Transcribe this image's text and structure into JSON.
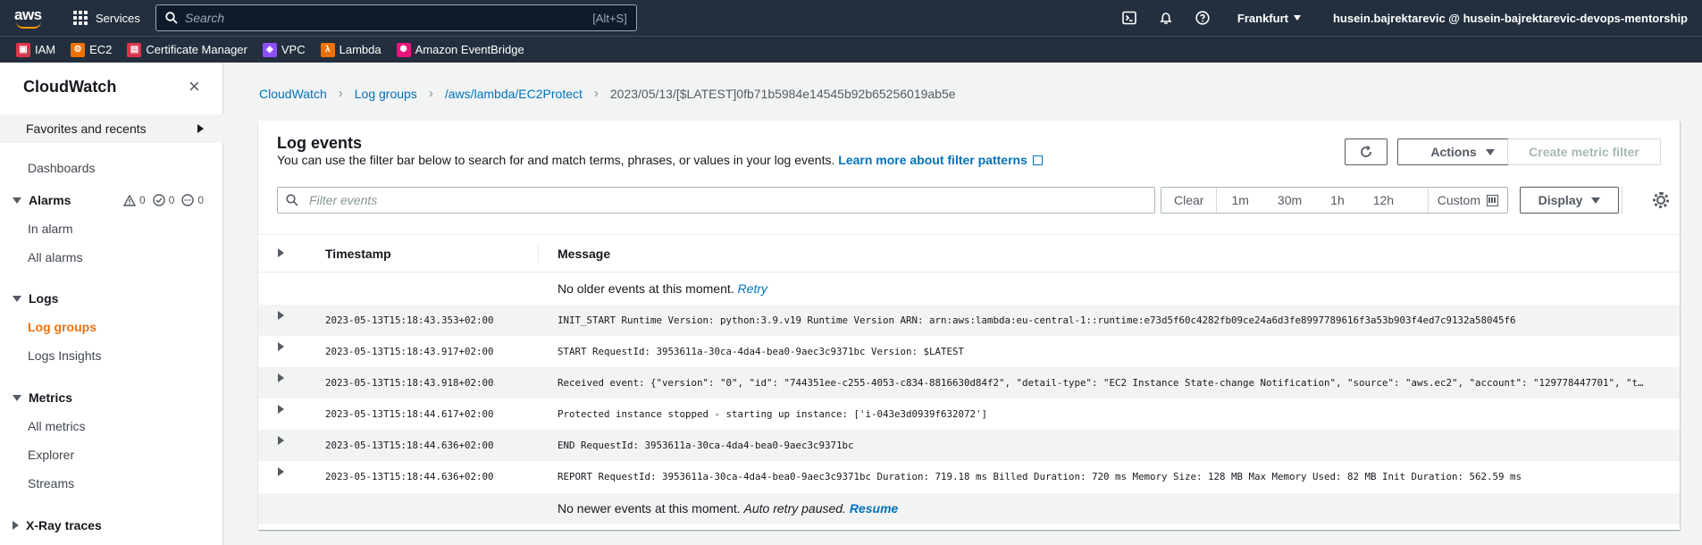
{
  "topnav": {
    "logo": "aws",
    "services_label": "Services",
    "search_placeholder": "Search",
    "search_shortcut": "[Alt+S]",
    "region": "Frankfurt",
    "account": "husein.bajrektarevic @ husein-bajrektarevic-devops-mentorship"
  },
  "favorites": [
    {
      "label": "IAM",
      "icon": "iam-icon",
      "color": "#dd344c"
    },
    {
      "label": "EC2",
      "icon": "ec2-icon",
      "color": "#ed7100"
    },
    {
      "label": "Certificate Manager",
      "icon": "certificate-manager-icon",
      "color": "#dd344c"
    },
    {
      "label": "VPC",
      "icon": "vpc-icon",
      "color": "#8c4fff"
    },
    {
      "label": "Lambda",
      "icon": "lambda-icon",
      "color": "#ed7100"
    },
    {
      "label": "Amazon EventBridge",
      "icon": "eventbridge-icon",
      "color": "#e7157b"
    }
  ],
  "sidebar": {
    "title": "CloudWatch",
    "favorites_label": "Favorites and recents",
    "dashboards": "Dashboards",
    "alarms": {
      "label": "Alarms",
      "in_alarm_count": "0",
      "ok_count": "0",
      "insufficient_count": "0",
      "items": [
        "In alarm",
        "All alarms"
      ]
    },
    "logs": {
      "label": "Logs",
      "items": [
        "Log groups",
        "Logs Insights"
      ]
    },
    "metrics": {
      "label": "Metrics",
      "items": [
        "All metrics",
        "Explorer",
        "Streams"
      ]
    },
    "xray": "X-Ray traces"
  },
  "breadcrumb": [
    "CloudWatch",
    "Log groups",
    "/aws/lambda/EC2Protect",
    "2023/05/13/[$LATEST]0fb71b5984e14545b92b65256019ab5e"
  ],
  "panel": {
    "title": "Log events",
    "description": "You can use the filter bar below to search for and match terms, phrases, or values in your log events.",
    "learn_more": "Learn more about filter patterns",
    "actions_label": "Actions",
    "create_metric_filter_label": "Create metric filter",
    "filter_placeholder": "Filter events",
    "time_options": [
      "Clear",
      "1m",
      "30m",
      "1h",
      "12h"
    ],
    "custom_label": "Custom",
    "display_label": "Display"
  },
  "table": {
    "columns": [
      "Timestamp",
      "Message"
    ],
    "top_notice": "No older events at this moment.",
    "top_retry": "Retry",
    "rows": [
      {
        "ts": "2023-05-13T15:18:43.353+02:00",
        "msg": "INIT_START Runtime Version: python:3.9.v19 Runtime Version ARN: arn:aws:lambda:eu-central-1::runtime:e73d5f60c4282fb09ce24a6d3fe8997789616f3a53b903f4ed7c9132a58045f6"
      },
      {
        "ts": "2023-05-13T15:18:43.917+02:00",
        "msg": "START RequestId: 3953611a-30ca-4da4-bea0-9aec3c9371bc Version: $LATEST"
      },
      {
        "ts": "2023-05-13T15:18:43.918+02:00",
        "msg": "Received event: {\"version\": \"0\", \"id\": \"744351ee-c255-4053-c834-8816630d84f2\", \"detail-type\": \"EC2 Instance State-change Notification\", \"source\": \"aws.ec2\", \"account\": \"129778447701\", \"t…"
      },
      {
        "ts": "2023-05-13T15:18:44.617+02:00",
        "msg": "Protected instance stopped - starting up instance: ['i-043e3d0939f632072']"
      },
      {
        "ts": "2023-05-13T15:18:44.636+02:00",
        "msg": "END RequestId: 3953611a-30ca-4da4-bea0-9aec3c9371bc"
      },
      {
        "ts": "2023-05-13T15:18:44.636+02:00",
        "msg": "REPORT RequestId: 3953611a-30ca-4da4-bea0-9aec3c9371bc Duration: 719.18 ms Billed Duration: 720 ms Memory Size: 128 MB Max Memory Used: 82 MB Init Duration: 562.59 ms"
      }
    ],
    "bottom_notice": "No newer events at this moment.",
    "bottom_paused": "Auto retry paused.",
    "bottom_resume": "Resume"
  }
}
